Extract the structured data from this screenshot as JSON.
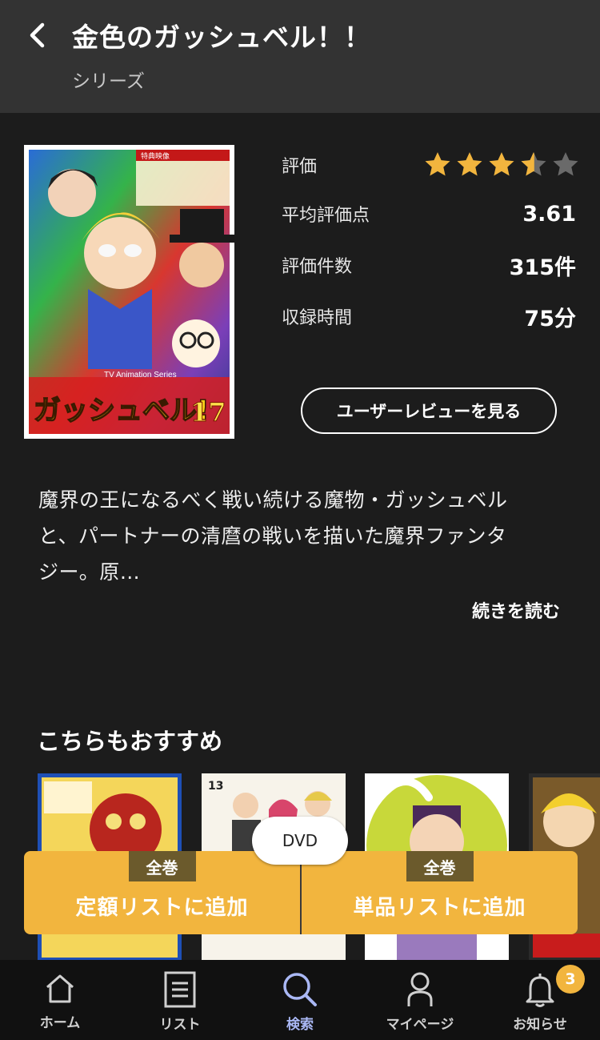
{
  "header": {
    "title": "金色のガッシュベル！！",
    "subtitle": "シリーズ"
  },
  "cover": {
    "badge_text": "特典映像",
    "series_text": "TV Animation Series",
    "logo_text": "ガッシュベル!",
    "volume": "17"
  },
  "stats": {
    "rating_label": "評価",
    "rating": 3.61,
    "avg_label": "平均評価点",
    "avg_value": "3.61",
    "count_label": "評価件数",
    "count_value": "315件",
    "duration_label": "収録時間",
    "duration_value": "75分"
  },
  "review_button": "ユーザーレビューを見る",
  "description": {
    "line1": "魔界の王になるべく戦い続ける魔物・ガッシュベル",
    "line2": "と、パートナーの清麿の戦いを描いた魔界ファンタ",
    "line3": "ジー。原…",
    "read_more": "続きを読む"
  },
  "recommend": {
    "title": "こちらもおすすめ",
    "item2_volume": "13"
  },
  "add_bar": {
    "format": "DVD",
    "left_tag": "全巻",
    "left_label": "定額リストに追加",
    "right_tag": "全巻",
    "right_label": "単品リストに追加"
  },
  "tabs": {
    "home": "ホーム",
    "list": "リスト",
    "search": "検索",
    "mypage": "マイページ",
    "notice": "お知らせ",
    "notice_badge": "3"
  },
  "colors": {
    "accent": "#f2b53e",
    "active_tab": "#aab8f5",
    "star": "#f2b53e",
    "star_empty": "#6a6a6a"
  }
}
